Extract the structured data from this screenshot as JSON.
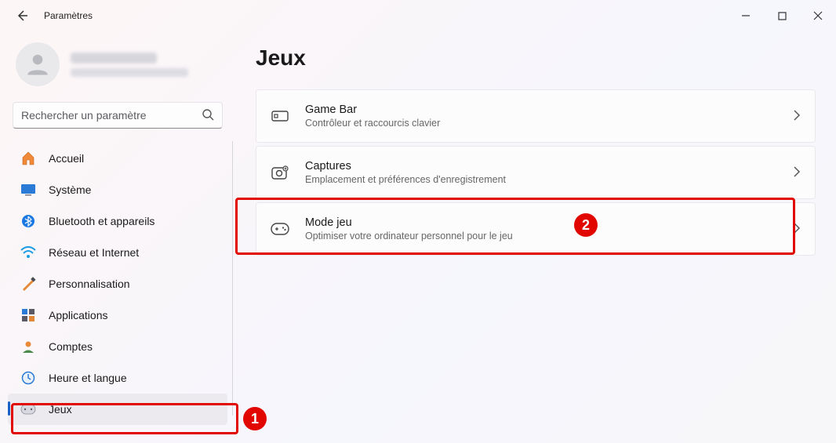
{
  "window": {
    "title": "Paramètres"
  },
  "search": {
    "placeholder": "Rechercher un paramètre"
  },
  "sidebar": {
    "items": [
      {
        "label": "Accueil"
      },
      {
        "label": "Système"
      },
      {
        "label": "Bluetooth et appareils"
      },
      {
        "label": "Réseau et Internet"
      },
      {
        "label": "Personnalisation"
      },
      {
        "label": "Applications"
      },
      {
        "label": "Comptes"
      },
      {
        "label": "Heure et langue"
      },
      {
        "label": "Jeux"
      }
    ]
  },
  "main": {
    "heading": "Jeux",
    "cards": [
      {
        "title": "Game Bar",
        "subtitle": "Contrôleur et raccourcis clavier"
      },
      {
        "title": "Captures",
        "subtitle": "Emplacement et préférences d'enregistrement"
      },
      {
        "title": "Mode jeu",
        "subtitle": "Optimiser votre ordinateur personnel pour le jeu"
      }
    ]
  },
  "annotations": {
    "badge1": "1",
    "badge2": "2"
  }
}
